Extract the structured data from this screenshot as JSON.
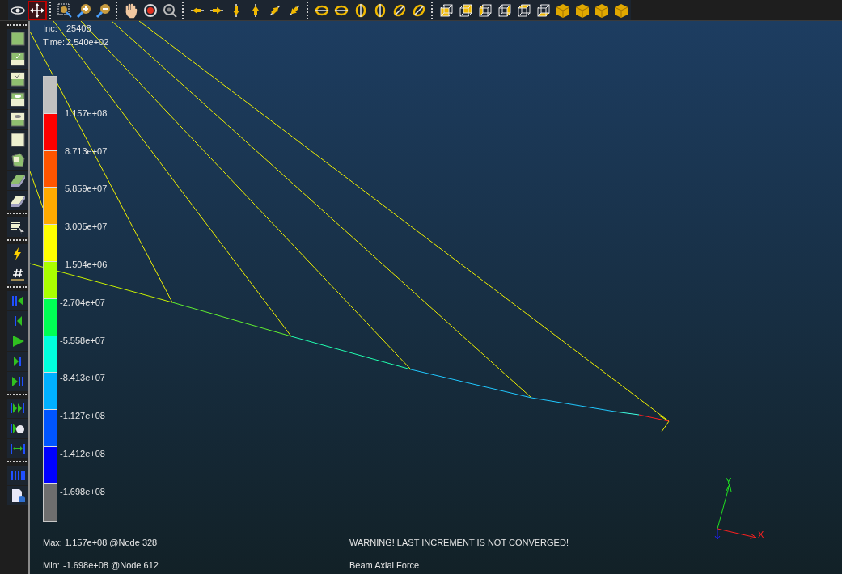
{
  "top_toolbar": [
    [
      {
        "kind": "eye",
        "selected": false
      },
      {
        "kind": "move",
        "selected": true
      }
    ],
    [
      {
        "kind": "zoom-box",
        "selected": false
      },
      {
        "kind": "zoom-in",
        "selected": false
      },
      {
        "kind": "zoom-out",
        "selected": false
      }
    ],
    [
      {
        "kind": "hand",
        "selected": false
      },
      {
        "kind": "rotate",
        "selected": false
      },
      {
        "kind": "rotate-reset",
        "selected": false
      }
    ],
    [
      {
        "kind": "arrow-left",
        "selected": false
      },
      {
        "kind": "arrow-right",
        "selected": false
      },
      {
        "kind": "arrow-down",
        "selected": false
      },
      {
        "kind": "arrow-up",
        "selected": false
      },
      {
        "kind": "diag-up",
        "selected": false
      },
      {
        "kind": "diag-down",
        "selected": false
      }
    ],
    [
      {
        "kind": "orbit-left",
        "selected": false
      },
      {
        "kind": "orbit-right",
        "selected": false
      },
      {
        "kind": "orbit-down",
        "selected": false
      },
      {
        "kind": "orbit-up",
        "selected": false
      },
      {
        "kind": "orbit-diag",
        "selected": false
      },
      {
        "kind": "orbit-diag",
        "selected": false
      }
    ],
    [
      {
        "kind": "cube-front",
        "selected": false
      },
      {
        "kind": "cube-back",
        "selected": false
      },
      {
        "kind": "cube-left",
        "selected": false
      },
      {
        "kind": "cube-right",
        "selected": false
      },
      {
        "kind": "cube-top",
        "selected": false
      },
      {
        "kind": "cube-bottom",
        "selected": false
      },
      {
        "kind": "cube-solid",
        "selected": false
      },
      {
        "kind": "cube-solid",
        "selected": false
      },
      {
        "kind": "cube-solid",
        "selected": false
      },
      {
        "kind": "cube-solid",
        "selected": false
      }
    ]
  ],
  "left_toolbar": [
    [
      {
        "kind": "face"
      },
      {
        "kind": "face-check-low"
      },
      {
        "kind": "face-check-high"
      },
      {
        "kind": "face-eye-low"
      },
      {
        "kind": "face-eye-high"
      },
      {
        "kind": "face-light"
      },
      {
        "kind": "face-3d"
      },
      {
        "kind": "plate"
      },
      {
        "kind": "plate-light"
      }
    ],
    [
      {
        "kind": "list-cursor"
      }
    ],
    [
      {
        "kind": "bolt"
      },
      {
        "kind": "hash"
      }
    ],
    [
      {
        "kind": "first"
      },
      {
        "kind": "prev"
      },
      {
        "kind": "play"
      },
      {
        "kind": "next"
      },
      {
        "kind": "last"
      }
    ],
    [
      {
        "kind": "fast"
      },
      {
        "kind": "record"
      },
      {
        "kind": "stretch"
      }
    ],
    [
      {
        "kind": "bars"
      },
      {
        "kind": "file-db"
      }
    ]
  ],
  "info": [
    {
      "label": "Inc:",
      "value": "25408"
    },
    {
      "label": "Time:",
      "value": "2.540e+02"
    }
  ],
  "legend": {
    "segments": [
      {
        "color": "#c0c0c0"
      },
      {
        "color": "#ff0000"
      },
      {
        "color": "#ff5500"
      },
      {
        "color": "#ffaa00"
      },
      {
        "color": "#ffff00"
      },
      {
        "color": "#aaff00"
      },
      {
        "color": "#00ff55"
      },
      {
        "color": "#00ffdd"
      },
      {
        "color": "#00b0ff"
      },
      {
        "color": "#0055ff"
      },
      {
        "color": "#0000ff"
      },
      {
        "color": "#6e6e6e"
      }
    ],
    "labels": [
      "1.157e+08",
      "8.713e+07",
      "5.859e+07",
      "3.005e+07",
      "1.504e+06",
      "-2.704e+07",
      "-5.558e+07",
      "-8.413e+07",
      "-1.127e+08",
      "-1.412e+08",
      "-1.698e+08"
    ]
  },
  "max": {
    "label": "Max:",
    "value": "1.157e+08 @Node  328"
  },
  "min": {
    "label": "Min:",
    "value": "-1.698e+08 @Node  612"
  },
  "warning": "WARNING! LAST INCREMENT IS NOT CONVERGED!",
  "result_title": "Beam Axial Force",
  "axes": {
    "x": "X",
    "y": "Y"
  }
}
